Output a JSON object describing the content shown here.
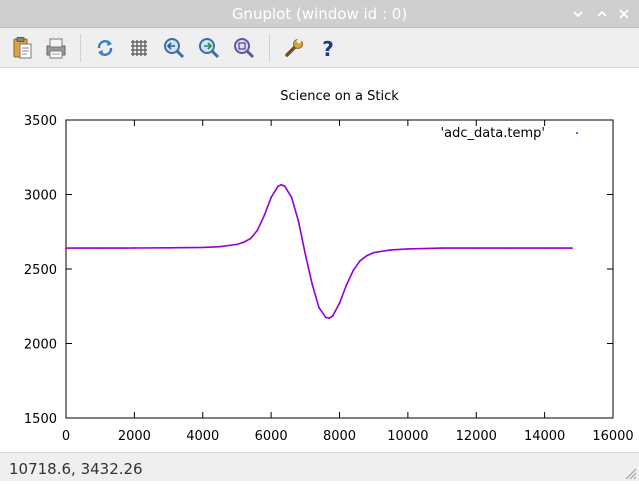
{
  "window": {
    "title": "Gnuplot (window id : 0)"
  },
  "toolbar": {
    "icons": [
      "clipboard-icon",
      "print-icon",
      "replot-icon",
      "grid-icon",
      "zoom-previous-icon",
      "zoom-next-icon",
      "autoscale-icon",
      "settings-icon",
      "help-icon"
    ]
  },
  "status": {
    "coords": "10718.6,  3432.26"
  },
  "colors": {
    "series": "#9400d3",
    "titlebar": "#cfcfcf",
    "toolbar": "#efefef"
  },
  "chart_data": {
    "type": "scatter",
    "title": "Science on a Stick",
    "xlabel": "",
    "ylabel": "",
    "xlim": [
      0,
      16000
    ],
    "ylim": [
      1500,
      3500
    ],
    "xticks": [
      "0",
      "2000",
      "4000",
      "6000",
      "8000",
      "10000",
      "12000",
      "14000",
      "16000"
    ],
    "yticks": [
      "1500",
      "2000",
      "2500",
      "3000",
      "3500"
    ],
    "grid": false,
    "legend_position": "top-right",
    "series": [
      {
        "name": "'adc_data.temp'",
        "x": [
          0,
          1000,
          2000,
          3000,
          4000,
          4500,
          5000,
          5200,
          5400,
          5600,
          5800,
          6000,
          6200,
          6300,
          6400,
          6600,
          6800,
          7000,
          7200,
          7400,
          7600,
          7700,
          7800,
          8000,
          8200,
          8400,
          8600,
          8800,
          9000,
          9500,
          10000,
          11000,
          12000,
          13000,
          14000,
          14800
        ],
        "y": [
          2640,
          2640,
          2641,
          2642,
          2645,
          2650,
          2665,
          2680,
          2705,
          2760,
          2860,
          2980,
          3055,
          3065,
          3055,
          2980,
          2820,
          2600,
          2400,
          2240,
          2175,
          2170,
          2185,
          2270,
          2390,
          2490,
          2555,
          2590,
          2610,
          2628,
          2635,
          2640,
          2640,
          2640,
          2640,
          2640
        ]
      }
    ]
  }
}
